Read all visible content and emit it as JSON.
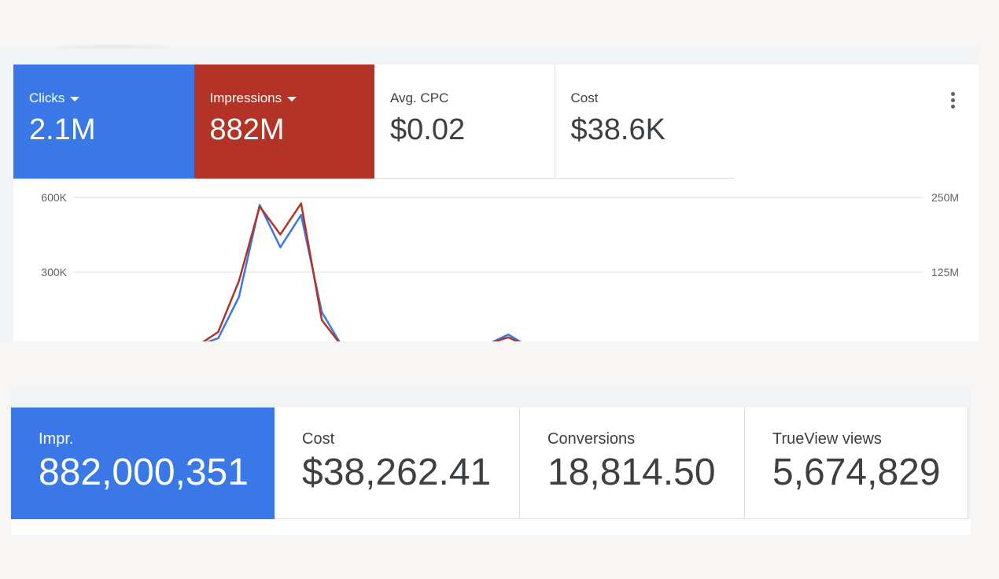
{
  "top_scorecards": [
    {
      "label": "Clicks",
      "value": "2.1M",
      "color": "#3b78e7",
      "has_dropdown": true
    },
    {
      "label": "Impressions",
      "value": "882M",
      "color": "#b33327",
      "has_dropdown": true
    },
    {
      "label": "Avg. CPC",
      "value": "$0.02",
      "has_dropdown": false
    },
    {
      "label": "Cost",
      "value": "$38.6K",
      "has_dropdown": false
    }
  ],
  "more_options_icon": "more-vert-icon",
  "chart": {
    "left_axis_ticks": [
      "600K",
      "300K"
    ],
    "right_axis_ticks": [
      "250M",
      "125M"
    ],
    "left_axis_max": 600000,
    "right_axis_max": 250000000,
    "chart_data": {
      "type": "line",
      "x": [
        1,
        2,
        3,
        4,
        5,
        6,
        7,
        8,
        9,
        10,
        11,
        12,
        13,
        14,
        15,
        16,
        17,
        18,
        19,
        20,
        21,
        22,
        23,
        24,
        25,
        26,
        27,
        28,
        29,
        30,
        31,
        32,
        33,
        34,
        35,
        36,
        37,
        38,
        39,
        40,
        41,
        42
      ],
      "series": [
        {
          "name": "Clicks",
          "axis": "left",
          "color": "#3b78e7",
          "values": [
            0,
            0,
            0,
            0,
            8000,
            12000,
            5000,
            35000,
            200000,
            570000,
            400000,
            530000,
            140000,
            0,
            0,
            0,
            0,
            0,
            0,
            0,
            10000,
            50000,
            0,
            0,
            0,
            0,
            12000,
            0,
            0,
            0,
            0,
            0,
            0,
            0,
            0,
            0,
            0,
            0,
            0,
            0,
            0,
            0
          ]
        },
        {
          "name": "Impressions",
          "axis": "right",
          "color": "#b33327",
          "values": [
            0,
            0,
            0,
            0,
            3000000,
            4000000,
            2000000,
            25000000,
            110000000,
            235000000,
            188000000,
            240000000,
            45000000,
            0,
            0,
            0,
            0,
            0,
            0,
            0,
            5000000,
            16000000,
            0,
            0,
            0,
            0,
            0,
            0,
            0,
            0,
            0,
            0,
            0,
            0,
            0,
            0,
            0,
            0,
            0,
            0,
            0,
            0
          ]
        }
      ]
    }
  },
  "bottom_scorecards": [
    {
      "label": "Impr.",
      "value": "882,000,351"
    },
    {
      "label": "Cost",
      "value": "$38,262.41"
    },
    {
      "label": "Conversions",
      "value": "18,814.50"
    },
    {
      "label": "TrueView views",
      "value": "5,674,829"
    }
  ],
  "colors": {
    "blue": "#3b78e7",
    "red": "#b33327",
    "grid": "#dadce0"
  }
}
